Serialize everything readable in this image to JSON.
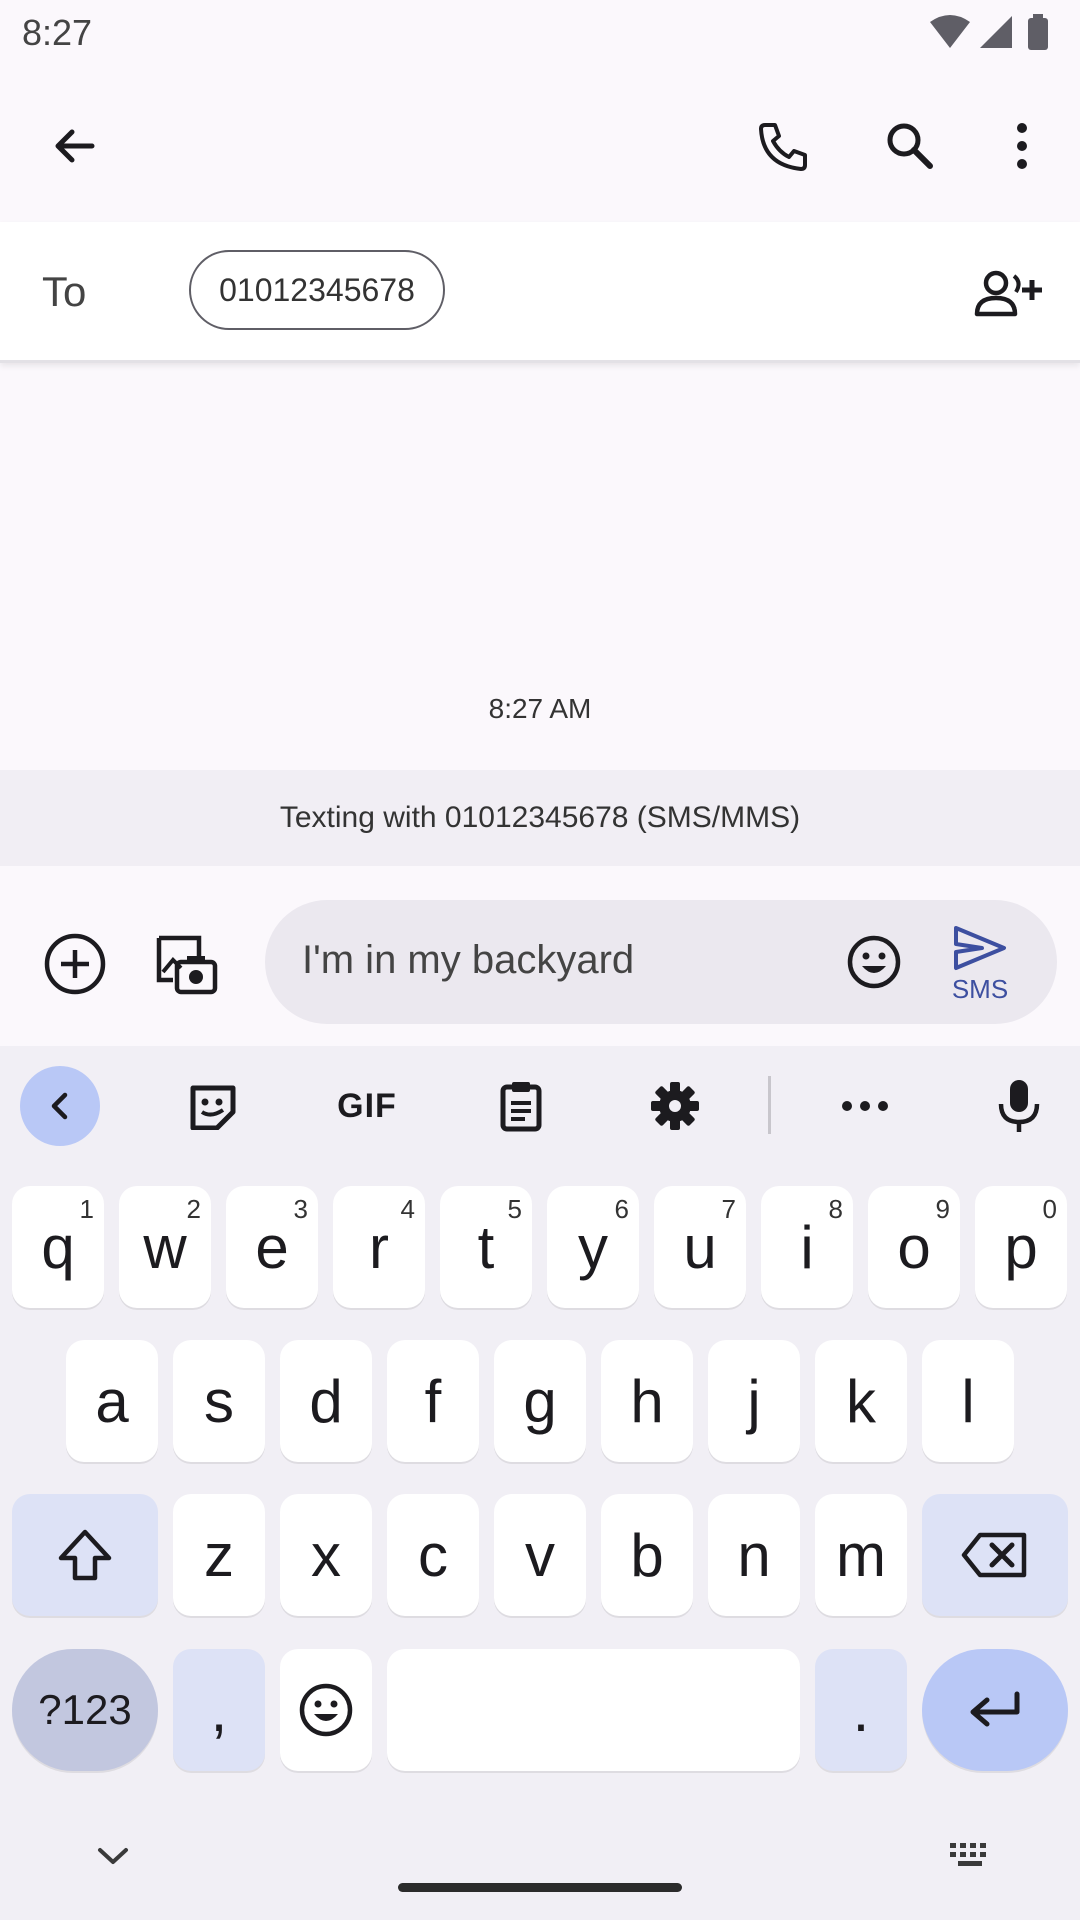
{
  "status_bar": {
    "time": "8:27"
  },
  "app_bar": {
    "icons": [
      "back-arrow-icon",
      "phone-icon",
      "search-icon",
      "more-vert-icon"
    ]
  },
  "recipient": {
    "to_label": "To",
    "chip": "01012345678"
  },
  "conversation": {
    "timestamp": "8:27 AM",
    "banner": "Texting with 01012345678 (SMS/MMS)"
  },
  "compose": {
    "text": "I'm in my backyard",
    "send_label": "SMS"
  },
  "keyboard": {
    "toolbar": [
      "sticker-icon",
      "gif-icon",
      "clipboard-icon",
      "settings-icon",
      "more-horiz-icon",
      "mic-icon"
    ],
    "gif_label": "GIF",
    "row1": [
      {
        "k": "q",
        "h": "1"
      },
      {
        "k": "w",
        "h": "2"
      },
      {
        "k": "e",
        "h": "3"
      },
      {
        "k": "r",
        "h": "4"
      },
      {
        "k": "t",
        "h": "5"
      },
      {
        "k": "y",
        "h": "6"
      },
      {
        "k": "u",
        "h": "7"
      },
      {
        "k": "i",
        "h": "8"
      },
      {
        "k": "o",
        "h": "9"
      },
      {
        "k": "p",
        "h": "0"
      }
    ],
    "row2": [
      "a",
      "s",
      "d",
      "f",
      "g",
      "h",
      "j",
      "k",
      "l"
    ],
    "row3": [
      "z",
      "x",
      "c",
      "v",
      "b",
      "n",
      "m"
    ],
    "symbols_key": "?123",
    "comma_key": ",",
    "period_key": "."
  },
  "colors": {
    "accent": "#b9c8f6",
    "modifier_key": "#dde2f6",
    "send": "#3d4fa0"
  }
}
